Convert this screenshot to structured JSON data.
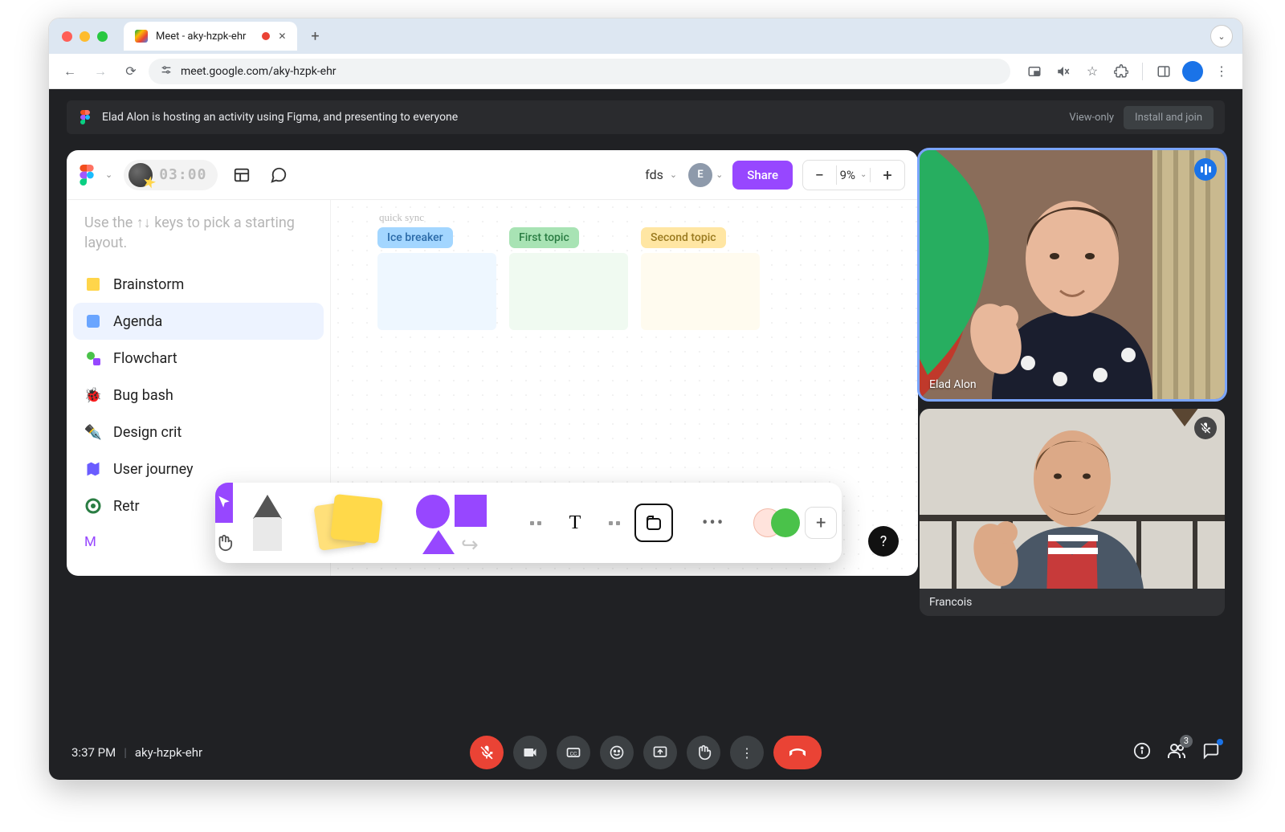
{
  "browser": {
    "tab_title": "Meet - aky-hzpk-ehr",
    "url": "meet.google.com/aky-hzpk-ehr"
  },
  "banner": {
    "text": "Elad Alon is hosting an activity using Figma, and presenting to everyone",
    "view_only": "View-only",
    "install": "Install and join"
  },
  "figma": {
    "timer": "03:00",
    "title": "fds",
    "avatar_initial": "E",
    "share": "Share",
    "zoom": "9%",
    "hint": "Use the ↑↓ keys to pick a starting layout.",
    "templates": [
      {
        "label": "Brainstorm"
      },
      {
        "label": "Agenda"
      },
      {
        "label": "Flowchart"
      },
      {
        "label": "Bug bash"
      },
      {
        "label": "Design crit"
      },
      {
        "label": "User journey"
      },
      {
        "label": "Retr"
      }
    ],
    "more": "M",
    "canvas": {
      "handwriting": "quick sync",
      "columns": [
        {
          "label": "Ice breaker"
        },
        {
          "label": "First topic"
        },
        {
          "label": "Second topic"
        }
      ]
    },
    "help": "?"
  },
  "participants": [
    {
      "name": "Elad Alon",
      "speaking": true,
      "muted": false
    },
    {
      "name": "Francois",
      "speaking": false,
      "muted": true
    }
  ],
  "bottom": {
    "time": "3:37 PM",
    "code": "aky-hzpk-ehr",
    "people_count": "3"
  }
}
